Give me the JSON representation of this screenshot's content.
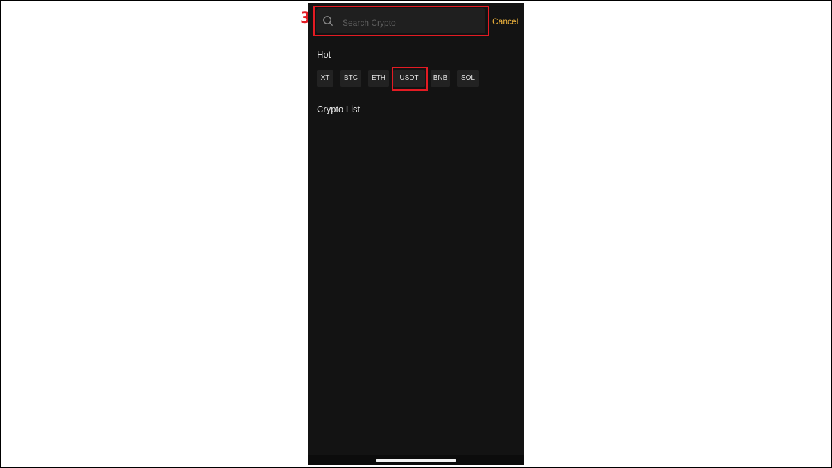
{
  "annotation": {
    "step_number": "3",
    "highlight_color": "#e31b23"
  },
  "search": {
    "placeholder": "Search Crypto",
    "value": "",
    "icon": "search-icon",
    "cancel_label": "Cancel",
    "cancel_color": "#f0b43c"
  },
  "hot": {
    "title": "Hot",
    "chips": [
      {
        "label": "XT"
      },
      {
        "label": "BTC"
      },
      {
        "label": "ETH"
      },
      {
        "label": "USDT"
      },
      {
        "label": "BNB"
      },
      {
        "label": "SOL"
      }
    ]
  },
  "crypto_list": {
    "title": "Crypto List"
  },
  "theme": {
    "background": "#131313",
    "chip_background": "#222222"
  }
}
